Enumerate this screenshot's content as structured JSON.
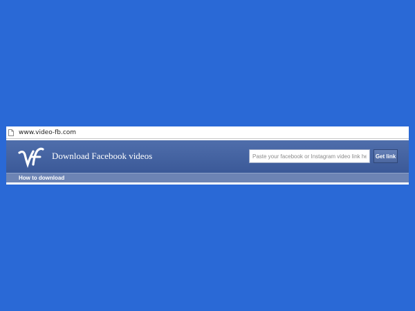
{
  "browser": {
    "url": "www.video-fb.com"
  },
  "header": {
    "title": "Download Facebook videos",
    "search_placeholder": "Paste your facebook or Instagram video link here...",
    "get_link_label": "Get link"
  },
  "nav": {
    "how_to_download": "How to download"
  },
  "colors": {
    "background": "#2a69d6",
    "header": "#3b5998",
    "nav": "#6d84b4"
  }
}
